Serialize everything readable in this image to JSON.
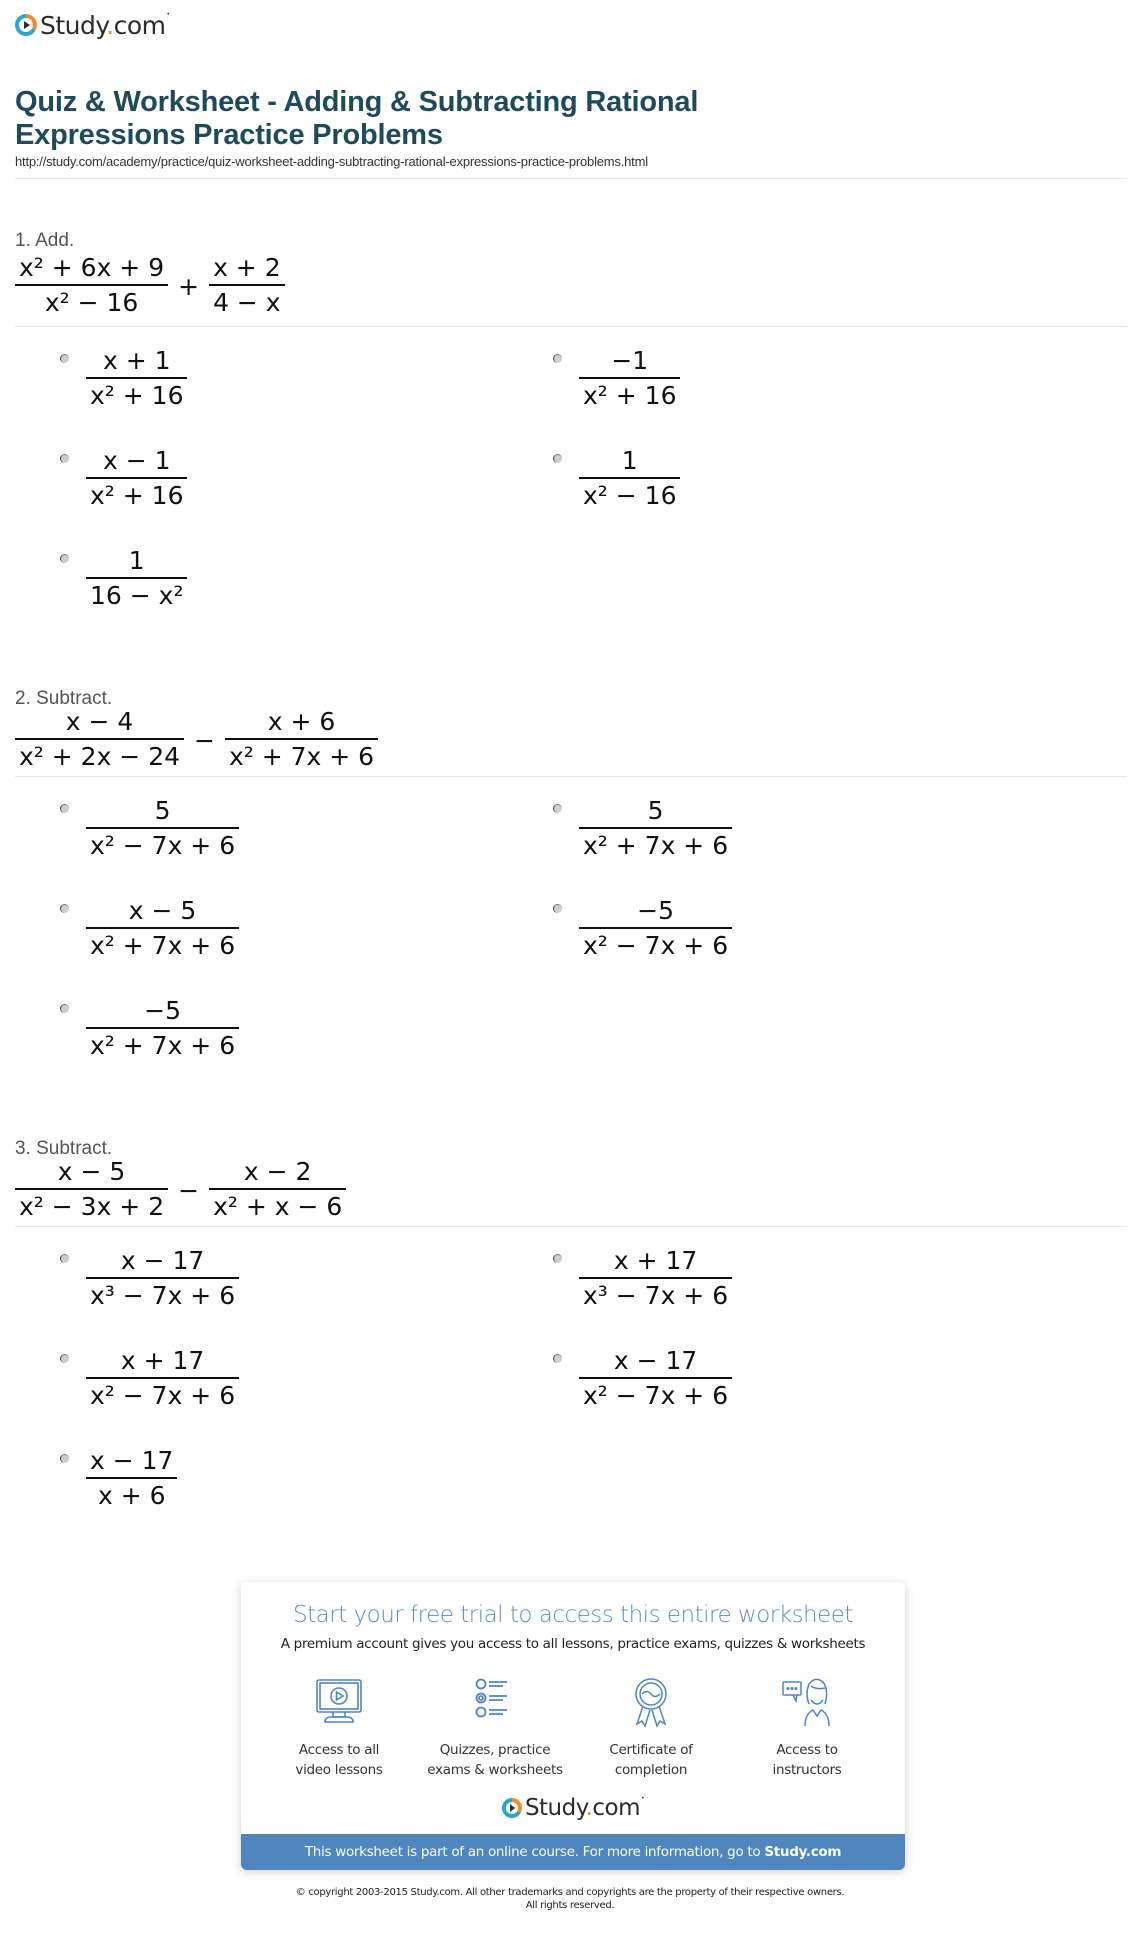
{
  "header": {
    "brand": "Study",
    "brand_dot": ".",
    "brand_tld": "com",
    "brand_tm": "•",
    "title": "Quiz & Worksheet - Adding & Subtracting Rational Expressions Practice Problems",
    "url": "http://study.com/academy/practice/quiz-worksheet-adding-subtracting-rational-expressions-practice-problems.html"
  },
  "questions": [
    {
      "label": "1. Add.",
      "expression": {
        "left": {
          "num": "x² + 6x + 9",
          "den": "x² − 16"
        },
        "operator": "+",
        "right": {
          "num": "x + 2",
          "den": "4 − x"
        }
      },
      "options": [
        {
          "num": "x + 1",
          "den": "x² + 16"
        },
        {
          "num": "−1",
          "den": "x² + 16"
        },
        {
          "num": "x − 1",
          "den": "x² + 16"
        },
        {
          "num": "1",
          "den": "x² − 16"
        },
        {
          "num": "1",
          "den": "16 − x²"
        }
      ]
    },
    {
      "label": "2. Subtract.",
      "expression": {
        "left": {
          "num": "x − 4",
          "den": "x² + 2x − 24"
        },
        "operator": "−",
        "right": {
          "num": "x + 6",
          "den": "x² + 7x + 6"
        }
      },
      "options": [
        {
          "num": "5",
          "den": "x² − 7x + 6"
        },
        {
          "num": "5",
          "den": "x² + 7x + 6"
        },
        {
          "num": "x − 5",
          "den": "x² + 7x + 6"
        },
        {
          "num": "−5",
          "den": "x² − 7x + 6"
        },
        {
          "num": "−5",
          "den": "x² + 7x + 6"
        }
      ]
    },
    {
      "label": "3. Subtract.",
      "expression": {
        "left": {
          "num": "x − 5",
          "den": "x² − 3x + 2"
        },
        "operator": "−",
        "right": {
          "num": "x − 2",
          "den": "x² + x − 6"
        }
      },
      "options": [
        {
          "num": "x − 17",
          "den": "x³ − 7x + 6"
        },
        {
          "num": "x + 17",
          "den": "x³ − 7x + 6"
        },
        {
          "num": "x + 17",
          "den": "x² − 7x + 6"
        },
        {
          "num": "x − 17",
          "den": "x² − 7x + 6"
        },
        {
          "num": "x − 17",
          "den": "x + 6"
        }
      ]
    }
  ],
  "promo": {
    "title": "Start your free trial to access this entire worksheet",
    "subtitle": "A premium account gives you access to all lessons, practice exams, quizzes & worksheets",
    "features": [
      {
        "icon": "video-monitor-icon",
        "line1": "Access to all",
        "line2": "video lessons"
      },
      {
        "icon": "checklist-icon",
        "line1": "Quizzes, practice",
        "line2": "exams & worksheets"
      },
      {
        "icon": "certificate-ribbon-icon",
        "line1": "Certificate of",
        "line2": "completion"
      },
      {
        "icon": "instructor-chat-icon",
        "line1": "Access to",
        "line2": "instructors"
      }
    ],
    "bar_text": "This worksheet is part of an online course. For more information, go to",
    "bar_link": "Study.com"
  },
  "footer": {
    "copyright_line1": "© copyright 2003-2015 Study.com. All other trademarks and copyrights are the property of their respective owners.",
    "copyright_line2": "All rights reserved."
  },
  "colors": {
    "title": "#1e4b5a",
    "promo_title": "#5b8fbf",
    "promo_bar": "#4f86bd",
    "brand_orange": "#f28b30",
    "brand_teal": "#2aa7c9"
  }
}
